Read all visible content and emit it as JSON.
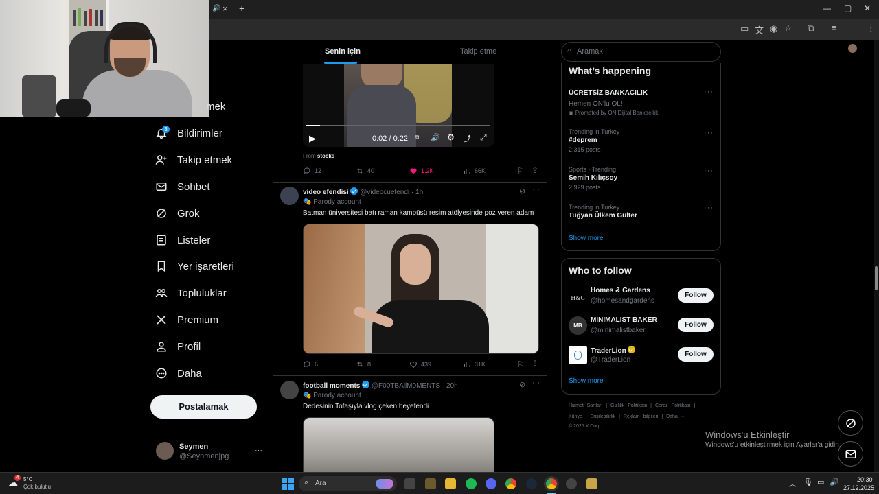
{
  "browser": {
    "tab_close": "×",
    "new_tab": "+",
    "window_controls": [
      "—",
      "▢",
      "✕"
    ]
  },
  "nav": {
    "items": [
      {
        "label": "mek",
        "icon": "search-icon"
      },
      {
        "label": "Bildirimler",
        "icon": "bell-icon",
        "badge": "3"
      },
      {
        "label": "Takip etmek",
        "icon": "add-person-icon"
      },
      {
        "label": "Sohbet",
        "icon": "mail-icon"
      },
      {
        "label": "Grok",
        "icon": "grok-icon"
      },
      {
        "label": "Listeler",
        "icon": "list-icon"
      },
      {
        "label": "Yer işaretleri",
        "icon": "bookmark-icon"
      },
      {
        "label": "Topluluklar",
        "icon": "communities-icon"
      },
      {
        "label": "Premium",
        "icon": "x-logo-icon"
      },
      {
        "label": "Profil",
        "icon": "profile-icon"
      },
      {
        "label": "Daha",
        "icon": "more-circle-icon"
      }
    ],
    "post_button": "Postalamak",
    "user": {
      "name": "Seymen",
      "handle": "@Seynmenjpg",
      "more": "···"
    }
  },
  "feed": {
    "tabs": [
      "Senin için",
      "Takip etme"
    ],
    "video_post": {
      "time": "0:02 / 0:22",
      "from_label": "From",
      "from_source": "stocks",
      "stats": {
        "replies": "12",
        "reposts": "40",
        "likes": "1.2K",
        "views": "66K"
      }
    },
    "posts": [
      {
        "name": "video efendisi",
        "handle": "@videocuefendi",
        "time": "· 1h",
        "parody": "Parody account",
        "text": "Batman üniversitesi batı raman kampüsü resim atölyesinde poz veren adam",
        "stats": {
          "replies": "6",
          "reposts": "8",
          "likes": "439",
          "views": "31K"
        }
      },
      {
        "name": "football moments",
        "handle": "@F00TBAllM0MENTS",
        "time": "· 20h",
        "parody": "Parody account",
        "text": "Dedesinin Tofaşıyla vlog çeken beyefendi"
      }
    ]
  },
  "right": {
    "search_placeholder": "Aramak",
    "happening": {
      "title": "What’s happening",
      "trends": [
        {
          "name": "ÜCRETSİZ BANKACILIK",
          "ctx": "Hemen ON'lu OL!",
          "sub": "Promoted by ON Dijital Bankacılık"
        },
        {
          "ctx": "Trending in Turkey",
          "name": "#deprem",
          "sub": "2,315 posts"
        },
        {
          "ctx": "Sports · Trending",
          "name": "Semih Kılıçsoy",
          "sub": "2,929 posts"
        },
        {
          "ctx": "Trending in Turkey",
          "name": "Tuğyan Ülkem Gülter",
          "sub": ""
        }
      ],
      "show_more": "Show more"
    },
    "who_to_follow": {
      "title": "Who to follow",
      "accounts": [
        {
          "name": "Homes & Gardens",
          "handle": "@homesandgardens",
          "button": "Follow"
        },
        {
          "name": "MINIMALIST BAKER",
          "handle": "@minimalistbaker",
          "button": "Follow"
        },
        {
          "name": "TraderLion",
          "handle": "@TraderLion",
          "button": "Follow"
        }
      ],
      "show_more": "Show more"
    },
    "footer": {
      "row1": [
        "Hizmet Şartları",
        "|",
        "Gizlilik Politikası",
        "|",
        "Çerez Politikası",
        "|"
      ],
      "row2": [
        "Künye",
        "|",
        "Erişilebilirlik",
        "|",
        "Reklam bilgileri",
        "|",
        "Daha ···"
      ],
      "copyright": "© 2025 X Corp."
    }
  },
  "watermark": {
    "title": "Windows'u Etkinleştir",
    "subtitle": "Windows'u etkinleştirmek için Ayarlar'a gidin."
  },
  "taskbar": {
    "weather_temp": "5°C",
    "weather_desc": "Çok bulutlu",
    "weather_badge": "4",
    "search_label": "Ara",
    "time": "20:30",
    "date": "27.12.2025"
  },
  "colors": {
    "accent": "#1d9bf0",
    "like": "#f91880",
    "background": "#000000"
  }
}
